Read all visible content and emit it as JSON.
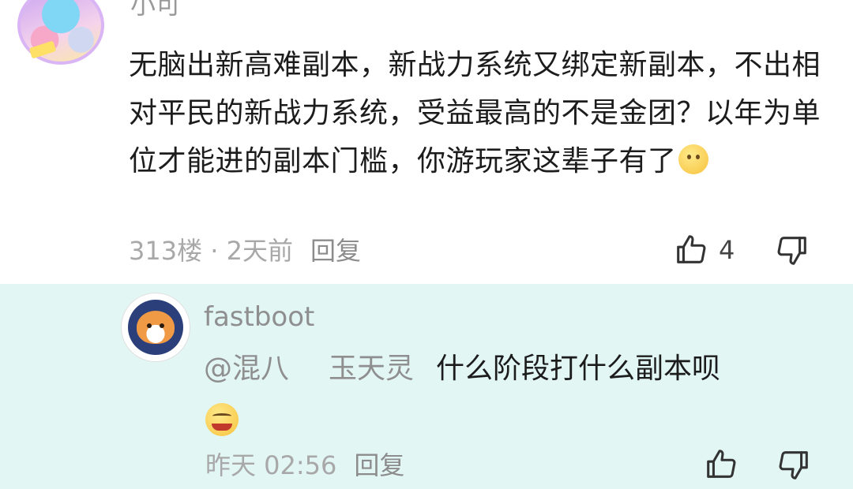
{
  "main_comment": {
    "author": "小可",
    "content": "无脑出新高难副本，新战力系统又绑定新副本，不出相对平民的新战力系统，受益最高的不是金团？以年为单位才能进的副本门槛，你游玩家这辈子有了",
    "emoji": "smile-emoji",
    "floor_and_time": "313楼 · 2天前",
    "reply_label": "回复",
    "like_count": "4",
    "icons": {
      "like": "thumbs-up-icon",
      "dislike": "thumbs-down-icon"
    }
  },
  "reply_comment": {
    "author": "fastboot",
    "mention_prefix": "@混八",
    "mention_suffix": "玉天灵",
    "content": "什么阶段打什么副本呗",
    "emoji": "grin-emoji",
    "time": "昨天 02:56",
    "reply_label": "回复",
    "icons": {
      "like": "thumbs-up-icon",
      "dislike": "thumbs-down-icon"
    }
  },
  "colors": {
    "reply_background": "#e2f6f4",
    "meta_text": "#a8a8a8"
  }
}
